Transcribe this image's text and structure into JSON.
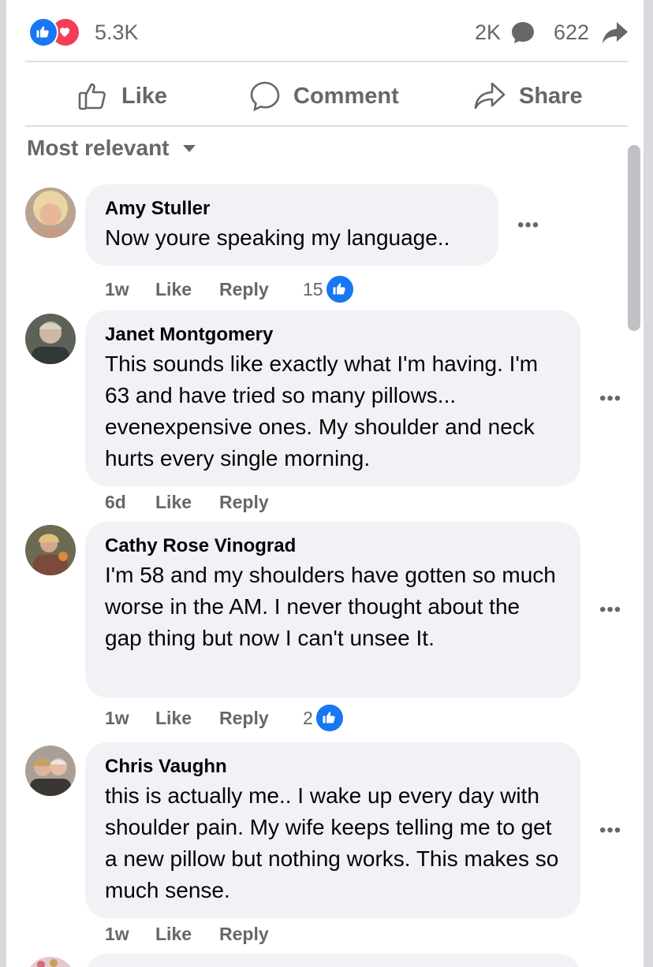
{
  "stats": {
    "reactions": "5.3K",
    "comments": "2K",
    "shares": "622"
  },
  "actions": {
    "like": "Like",
    "comment": "Comment",
    "share": "Share"
  },
  "sort": {
    "label": "Most relevant"
  },
  "comments": [
    {
      "author": "Amy Stuller",
      "text": "Now youre speaking my language..",
      "time": "1w",
      "like": "Like",
      "reply": "Reply",
      "likes": "15"
    },
    {
      "author": "Janet Montgomery",
      "text": "This sounds like exactly what I'm having. I'm 63 and have tried so many pillows... evenexpensive ones. My shoulder and neck hurts every single morning.",
      "time": "6d",
      "like": "Like",
      "reply": "Reply"
    },
    {
      "author": "Cathy Rose Vinograd",
      "text": "I'm 58 and my shoulders have gotten so much worse in the AM. I never thought about the gap thing but now I can't unsee It.",
      "time": "1w",
      "like": "Like",
      "reply": "Reply",
      "likes": "2"
    },
    {
      "author": "Chris Vaughn",
      "text": "this is actually me.. I wake up every day with shoulder pain. My wife keeps telling me to get a new pillow but nothing works. This makes so much sense.",
      "time": "1w",
      "like": "Like",
      "reply": "Reply"
    }
  ],
  "colors": {
    "brand_blue": "#1877f2",
    "love_red": "#f33e58",
    "bubble_bg": "#f0f2f5",
    "muted_text": "#65676b"
  },
  "icons": [
    "like-reaction-icon",
    "love-reaction-icon",
    "comment-bubble-icon",
    "share-arrow-icon",
    "thumbs-up-icon",
    "comment-icon",
    "share-icon",
    "dropdown-caret-icon",
    "more-options-icon"
  ]
}
